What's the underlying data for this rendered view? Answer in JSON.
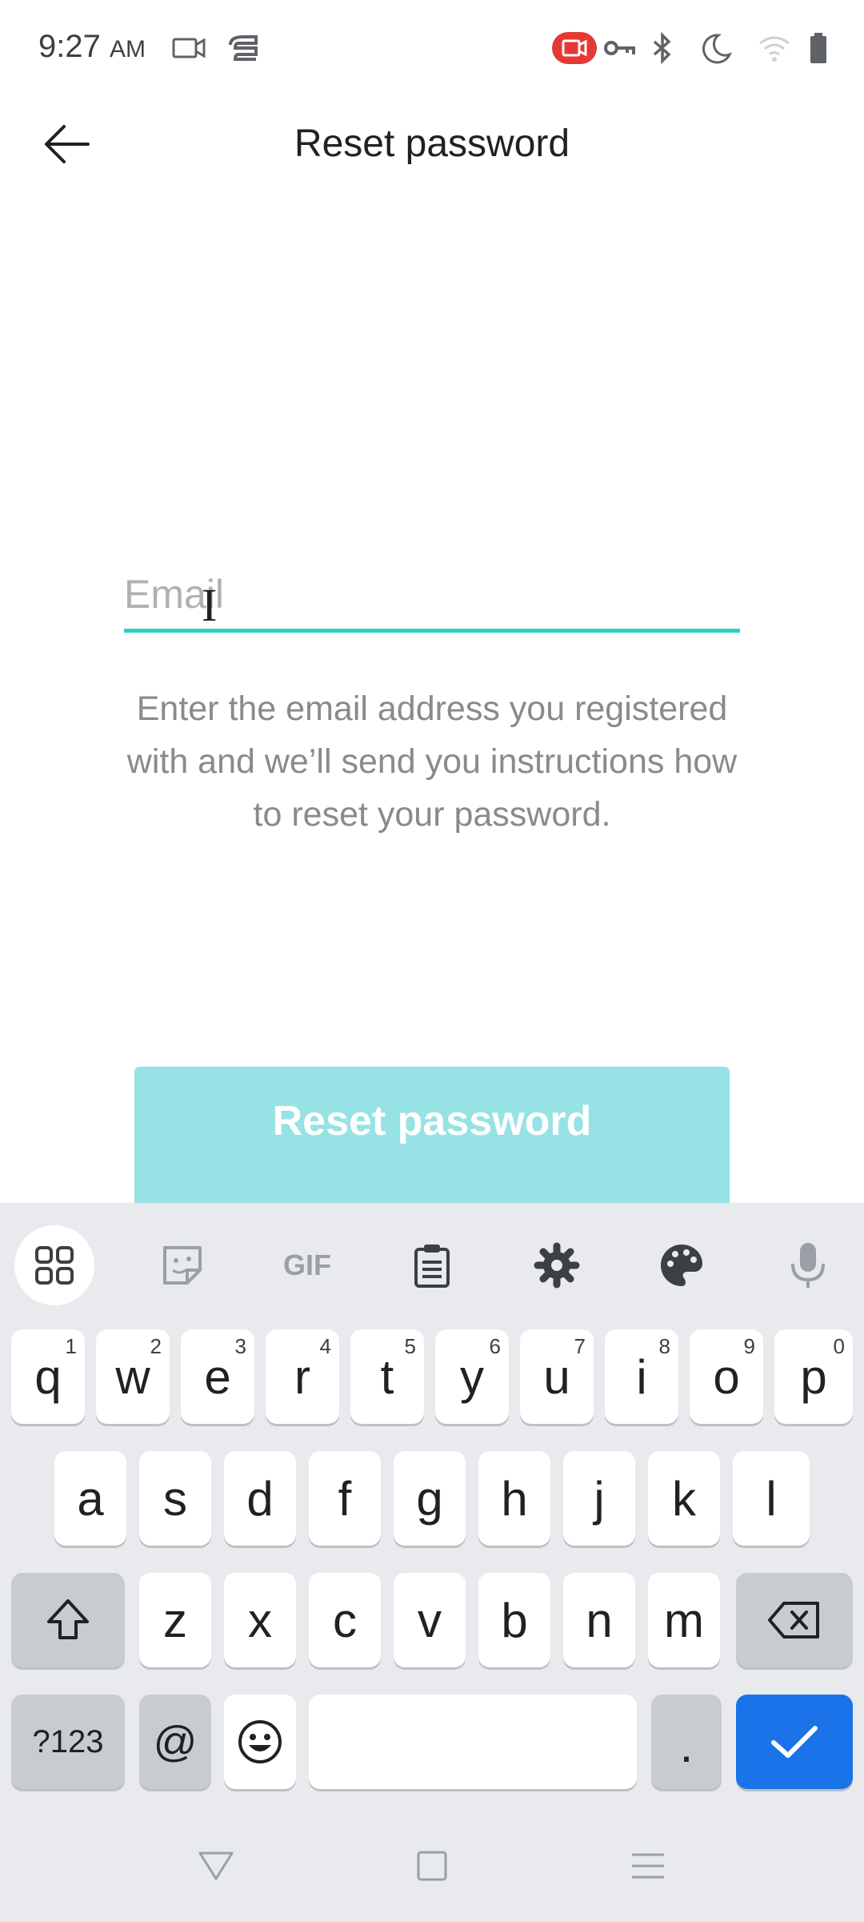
{
  "status_bar": {
    "time": "9:27",
    "ampm": "AM",
    "icons": [
      "video-call-icon",
      "app-notification-icon",
      "screen-record-icon",
      "vpn-key-icon",
      "bluetooth-icon",
      "do-not-disturb-moon-icon",
      "wifi-icon",
      "battery-icon"
    ],
    "record_color": "#e53935"
  },
  "header": {
    "title": "Reset password"
  },
  "form": {
    "email_placeholder": "Email",
    "email_value": "",
    "help_text": "Enter the email address you registered with and we’ll send you instructions how to reset your password.",
    "submit_label": "Reset password",
    "accent_color": "#2ccfc8",
    "button_color": "#97e2e4"
  },
  "keyboard": {
    "toolbar": [
      "apps-grid-icon",
      "sticker-icon",
      "gif-icon",
      "clipboard-icon",
      "settings-gear-icon",
      "theme-palette-icon",
      "microphone-icon"
    ],
    "gif_label": "GIF",
    "row1": [
      {
        "key": "q",
        "hint": "1"
      },
      {
        "key": "w",
        "hint": "2"
      },
      {
        "key": "e",
        "hint": "3"
      },
      {
        "key": "r",
        "hint": "4"
      },
      {
        "key": "t",
        "hint": "5"
      },
      {
        "key": "y",
        "hint": "6"
      },
      {
        "key": "u",
        "hint": "7"
      },
      {
        "key": "i",
        "hint": "8"
      },
      {
        "key": "o",
        "hint": "9"
      },
      {
        "key": "p",
        "hint": "0"
      }
    ],
    "row2": [
      "a",
      "s",
      "d",
      "f",
      "g",
      "h",
      "j",
      "k",
      "l"
    ],
    "row3": [
      "z",
      "x",
      "c",
      "v",
      "b",
      "n",
      "m"
    ],
    "symbols_label": "?123",
    "at_label": "@",
    "period_label": ".",
    "enter_color": "#1a73e8"
  },
  "nav_bar": [
    "back-triangle-icon",
    "home-square-icon",
    "recents-menu-icon"
  ]
}
